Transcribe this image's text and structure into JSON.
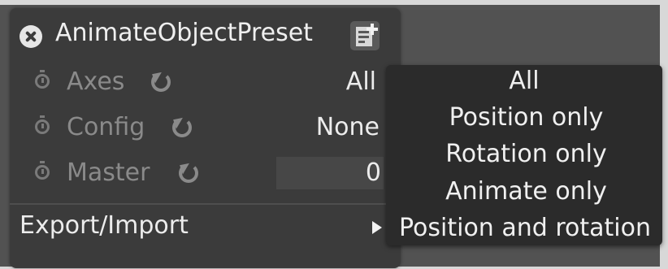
{
  "window": {
    "title": "AnimateObjectPreset"
  },
  "icons": {
    "close": "close-circle-icon",
    "preset": "preset-add-icon",
    "timer": "stopwatch-icon",
    "reset": "reset-icon",
    "submenu": "submenu-arrow-icon"
  },
  "properties": [
    {
      "label": "Axes",
      "value": "All"
    },
    {
      "label": "Config",
      "value": "None"
    },
    {
      "label": "Master",
      "value": "0"
    }
  ],
  "export_import": {
    "label": "Export/Import"
  },
  "dropdown": {
    "items": [
      "All",
      "Position only",
      "Rotation only",
      "Animate only",
      "Position and rotation"
    ]
  },
  "colors": {
    "panel_bg": "#3b3b3b",
    "dropdown_bg": "#2b2b2b",
    "text_active": "#ececec",
    "text_inactive": "#8a8a8a"
  }
}
